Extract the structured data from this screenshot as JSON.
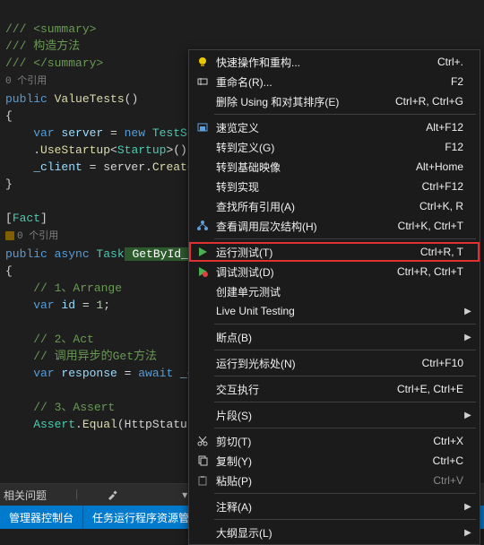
{
  "code": {
    "l1": "/// <summary>",
    "l2": "/// 构造方法",
    "l3": "/// </summary>",
    "l4_refs": "0 个引用",
    "l5_kw": "public",
    "l5_ident": " ValueTests",
    "l5_after": "()",
    "l6": "{",
    "l7_a": "    var",
    "l7_b": " server",
    "l7_c": " = ",
    "l7_d": "new",
    "l7_e": " TestServ",
    "l8_a": "    .",
    "l8_b": "UseStartup",
    "l8_c": "<",
    "l8_d": "Startup",
    "l8_e": ">());",
    "l9_a": "    _client",
    "l9_b": " = server.",
    "l9_c": "CreateCl",
    "l10": "}",
    "l12_a": "[",
    "l12_b": "Fact",
    "l12_c": "]",
    "l13_refs": "0 个引用",
    "l14_kw": "public async",
    "l14_type": " Task",
    "l14_method": " GetById_Sho",
    "l15": "{",
    "l16": "    // 1、Arrange",
    "l17_a": "    var",
    "l17_b": " id",
    "l17_c": " = ",
    "l17_d": "1",
    "l17_e": ";",
    "l19": "    // 2、Act",
    "l20": "    // 调用异步的Get方法",
    "l21_a": "    var",
    "l21_b": " response",
    "l21_c": " = ",
    "l21_d": "await",
    "l21_e": " _cl",
    "l23": "    // 3、Assert",
    "l24_a": "    Assert",
    "l24_b": ".",
    "l24_c": "Equal",
    "l24_d": "(HttpStatusCo"
  },
  "footer": {
    "top_label": "相关问题",
    "tab1": "管理器控制台",
    "tab2": "任务运行程序资源管理器"
  },
  "menu": {
    "items": [
      {
        "label": "快速操作和重构...",
        "shortcut": "Ctrl+.",
        "icon": "bulb"
      },
      {
        "label": "重命名(R)...",
        "shortcut": "F2",
        "icon": "rename"
      },
      {
        "label": "删除 Using 和对其排序(E)",
        "shortcut": "Ctrl+R, Ctrl+G"
      },
      "sep",
      {
        "label": "速览定义",
        "shortcut": "Alt+F12",
        "icon": "peek"
      },
      {
        "label": "转到定义(G)",
        "shortcut": "F12"
      },
      {
        "label": "转到基础映像",
        "shortcut": "Alt+Home"
      },
      {
        "label": "转到实现",
        "shortcut": "Ctrl+F12"
      },
      {
        "label": "查找所有引用(A)",
        "shortcut": "Ctrl+K, R"
      },
      {
        "label": "查看调用层次结构(H)",
        "shortcut": "Ctrl+K, Ctrl+T",
        "icon": "hierarchy"
      },
      "sep",
      {
        "label": "运行测试(T)",
        "shortcut": "Ctrl+R, T",
        "icon": "run",
        "highlight": true
      },
      {
        "label": "调试测试(D)",
        "shortcut": "Ctrl+R, Ctrl+T",
        "icon": "debug"
      },
      {
        "label": "创建单元测试"
      },
      {
        "label": "Live Unit Testing",
        "sub": true
      },
      "sep",
      {
        "label": "断点(B)",
        "sub": true
      },
      "sep",
      {
        "label": "运行到光标处(N)",
        "shortcut": "Ctrl+F10"
      },
      "sep",
      {
        "label": "交互执行",
        "shortcut": "Ctrl+E, Ctrl+E"
      },
      "sep",
      {
        "label": "片段(S)",
        "sub": true
      },
      "sep",
      {
        "label": "剪切(T)",
        "shortcut": "Ctrl+X",
        "icon": "cut"
      },
      {
        "label": "复制(Y)",
        "shortcut": "Ctrl+C",
        "icon": "copy"
      },
      {
        "label": "粘贴(P)",
        "shortcut": "Ctrl+V",
        "icon": "paste",
        "dim": true
      },
      "sep",
      {
        "label": "注释(A)",
        "sub": true
      },
      "sep",
      {
        "label": "大纲显示(L)",
        "sub": true
      }
    ]
  }
}
